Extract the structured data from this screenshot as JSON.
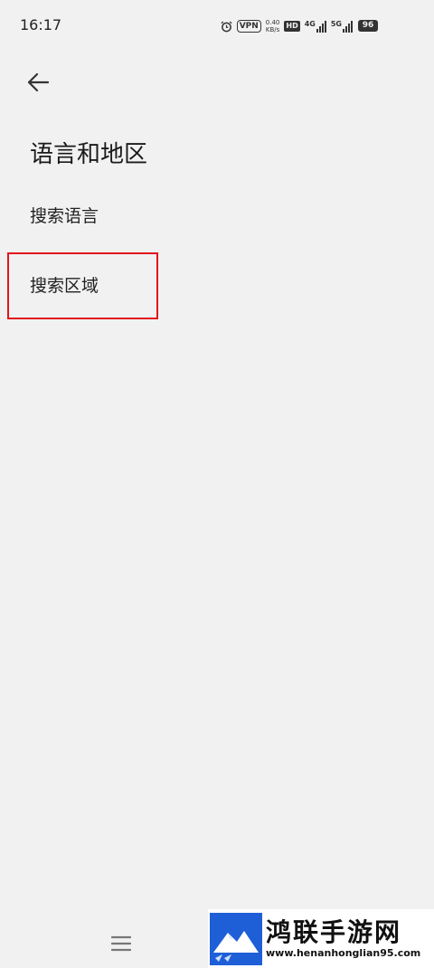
{
  "status_bar": {
    "time": "16:17",
    "vpn": "VPN",
    "speed_value": "0.40",
    "speed_unit": "KB/s",
    "hd": "HD",
    "net1": "4G",
    "net2": "5G",
    "battery": "96"
  },
  "header": {
    "title": "语言和地区"
  },
  "menu": {
    "items": [
      {
        "label": "搜索语言"
      },
      {
        "label": "搜索区域"
      }
    ]
  },
  "watermark": {
    "title": "鸿联手游网",
    "url": "www.henanhonglian95.com"
  },
  "colors": {
    "background": "#f1f1f1",
    "highlight": "#e0151c"
  }
}
